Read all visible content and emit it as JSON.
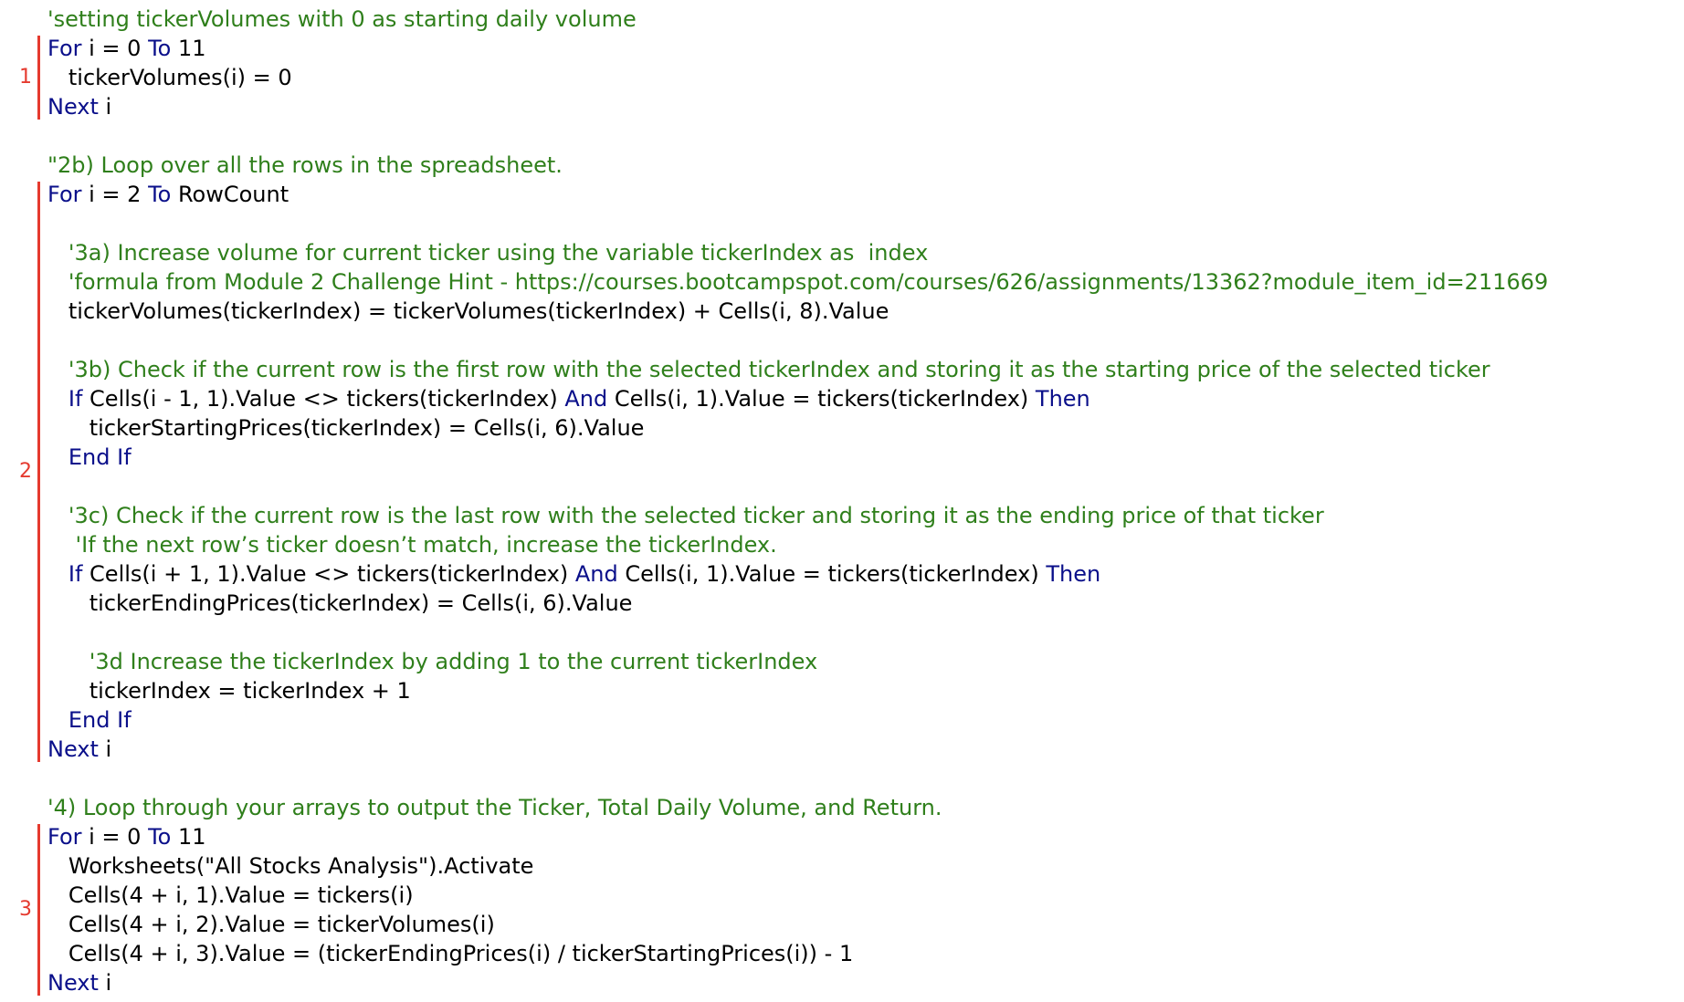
{
  "colors": {
    "keyword": "#0a0f8a",
    "comment": "#2f7f1b",
    "text": "#000000",
    "annotation": "#e53a2f"
  },
  "lines": [
    [
      {
        "t": "comment",
        "v": "'setting tickerVolumes with 0 as starting daily volume"
      }
    ],
    [
      {
        "t": "keyword",
        "v": "For"
      },
      {
        "t": "text",
        "v": " i = 0 "
      },
      {
        "t": "keyword",
        "v": "To"
      },
      {
        "t": "text",
        "v": " 11"
      }
    ],
    [
      {
        "t": "text",
        "v": "   tickerVolumes(i) = 0"
      }
    ],
    [
      {
        "t": "keyword",
        "v": "Next"
      },
      {
        "t": "text",
        "v": " i"
      }
    ],
    [],
    [
      {
        "t": "comment",
        "v": "\"2b) Loop over all the rows in the spreadsheet."
      }
    ],
    [
      {
        "t": "keyword",
        "v": "For"
      },
      {
        "t": "text",
        "v": " i = 2 "
      },
      {
        "t": "keyword",
        "v": "To"
      },
      {
        "t": "text",
        "v": " RowCount"
      }
    ],
    [],
    [
      {
        "t": "comment",
        "v": "   '3a) Increase volume for current ticker using the variable tickerIndex as  index"
      }
    ],
    [
      {
        "t": "comment",
        "v": "   'formula from Module 2 Challenge Hint - https://courses.bootcampspot.com/courses/626/assignments/13362?module_item_id=211669"
      }
    ],
    [
      {
        "t": "text",
        "v": "   tickerVolumes(tickerIndex) = tickerVolumes(tickerIndex) + Cells(i, 8).Value"
      }
    ],
    [],
    [
      {
        "t": "comment",
        "v": "   '3b) Check if the current row is the first row with the selected tickerIndex and storing it as the starting price of the selected ticker"
      }
    ],
    [
      {
        "t": "text",
        "v": "   "
      },
      {
        "t": "keyword",
        "v": "If"
      },
      {
        "t": "text",
        "v": " Cells(i - 1, 1).Value <> tickers(tickerIndex) "
      },
      {
        "t": "keyword",
        "v": "And"
      },
      {
        "t": "text",
        "v": " Cells(i, 1).Value = tickers(tickerIndex) "
      },
      {
        "t": "keyword",
        "v": "Then"
      }
    ],
    [
      {
        "t": "text",
        "v": "      tickerStartingPrices(tickerIndex) = Cells(i, 6).Value"
      }
    ],
    [
      {
        "t": "text",
        "v": "   "
      },
      {
        "t": "keyword",
        "v": "End If"
      }
    ],
    [],
    [
      {
        "t": "comment",
        "v": "   '3c) Check if the current row is the last row with the selected ticker and storing it as the ending price of that ticker"
      }
    ],
    [
      {
        "t": "comment",
        "v": "    'If the next row’s ticker doesn’t match, increase the tickerIndex."
      }
    ],
    [
      {
        "t": "text",
        "v": "   "
      },
      {
        "t": "keyword",
        "v": "If"
      },
      {
        "t": "text",
        "v": " Cells(i + 1, 1).Value <> tickers(tickerIndex) "
      },
      {
        "t": "keyword",
        "v": "And"
      },
      {
        "t": "text",
        "v": " Cells(i, 1).Value = tickers(tickerIndex) "
      },
      {
        "t": "keyword",
        "v": "Then"
      }
    ],
    [
      {
        "t": "text",
        "v": "      tickerEndingPrices(tickerIndex) = Cells(i, 6).Value"
      }
    ],
    [],
    [
      {
        "t": "comment",
        "v": "      '3d Increase the tickerIndex by adding 1 to the current tickerIndex"
      }
    ],
    [
      {
        "t": "text",
        "v": "      tickerIndex = tickerIndex + 1"
      }
    ],
    [
      {
        "t": "text",
        "v": "   "
      },
      {
        "t": "keyword",
        "v": "End If"
      }
    ],
    [
      {
        "t": "keyword",
        "v": "Next"
      },
      {
        "t": "text",
        "v": " i"
      }
    ],
    [],
    [
      {
        "t": "comment",
        "v": "'4) Loop through your arrays to output the Ticker, Total Daily Volume, and Return."
      }
    ],
    [
      {
        "t": "keyword",
        "v": "For"
      },
      {
        "t": "text",
        "v": " i = 0 "
      },
      {
        "t": "keyword",
        "v": "To"
      },
      {
        "t": "text",
        "v": " 11"
      }
    ],
    [
      {
        "t": "text",
        "v": "   Worksheets(\"All Stocks Analysis\").Activate"
      }
    ],
    [
      {
        "t": "text",
        "v": "   Cells(4 + i, 1).Value = tickers(i)"
      }
    ],
    [
      {
        "t": "text",
        "v": "   Cells(4 + i, 2).Value = tickerVolumes(i)"
      }
    ],
    [
      {
        "t": "text",
        "v": "   Cells(4 + i, 3).Value = (tickerEndingPrices(i) / tickerStartingPrices(i)) - 1"
      }
    ],
    [
      {
        "t": "keyword",
        "v": "Next"
      },
      {
        "t": "text",
        "v": " i"
      }
    ]
  ],
  "blocks": [
    {
      "label": "1",
      "start": 1,
      "end": 3
    },
    {
      "label": "2",
      "start": 6,
      "end": 25
    },
    {
      "label": "3",
      "start": 28,
      "end": 33
    }
  ]
}
